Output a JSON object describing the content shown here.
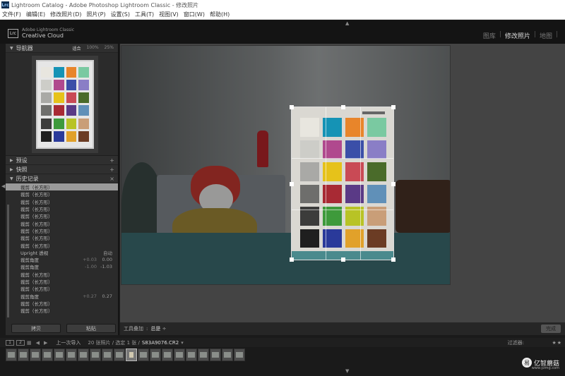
{
  "titlebar": {
    "icon": "Lrc",
    "title": "Lightroom Catalog - Adobe Photoshop Lightroom Classic - 修改照片"
  },
  "menu": [
    "文件(F)",
    "编辑(E)",
    "修改照片(D)",
    "照片(P)",
    "设置(S)",
    "工具(T)",
    "视图(V)",
    "窗口(W)",
    "帮助(H)"
  ],
  "identity": {
    "logo": "Lrc",
    "line1": "Adobe Lightroom Classic",
    "line2": "Creative Cloud"
  },
  "modules": [
    "图库",
    "修改照片",
    "地图"
  ],
  "navigator": {
    "title": "导航器",
    "zoom": [
      "适合",
      "100%",
      "25%"
    ]
  },
  "panels": {
    "presets": "预设",
    "snapshots": "快照",
    "history": "历史记录"
  },
  "history": [
    {
      "label": "裁剪（长方形）",
      "v1": "",
      "v2": ""
    },
    {
      "label": "裁剪（长方形）",
      "v1": "",
      "v2": ""
    },
    {
      "label": "裁剪（长方形）",
      "v1": "",
      "v2": ""
    },
    {
      "label": "裁剪（长方形）",
      "v1": "",
      "v2": ""
    },
    {
      "label": "裁剪（长方形）",
      "v1": "",
      "v2": ""
    },
    {
      "label": "裁剪（长方形）",
      "v1": "",
      "v2": ""
    },
    {
      "label": "裁剪（长方形）",
      "v1": "",
      "v2": ""
    },
    {
      "label": "裁剪（长方形）",
      "v1": "",
      "v2": ""
    },
    {
      "label": "裁剪（长方形）",
      "v1": "",
      "v2": ""
    },
    {
      "label": "Upright 透视",
      "v1": "",
      "v2": "自动"
    },
    {
      "label": "裁剪角度",
      "v1": "+0.03",
      "v2": "0.00"
    },
    {
      "label": "裁剪角度",
      "v1": "-1.00",
      "v2": "-1.03"
    },
    {
      "label": "裁剪（长方形）",
      "v1": "",
      "v2": ""
    },
    {
      "label": "裁剪（长方形）",
      "v1": "",
      "v2": ""
    },
    {
      "label": "裁剪（长方形）",
      "v1": "",
      "v2": ""
    },
    {
      "label": "裁剪角度",
      "v1": "+0.27",
      "v2": "0.27"
    },
    {
      "label": "裁剪（长方形）",
      "v1": "",
      "v2": ""
    },
    {
      "label": "裁剪（长方形）",
      "v1": "",
      "v2": ""
    }
  ],
  "buttons": {
    "copy": "拷贝",
    "paste": "粘贴",
    "done": "完成"
  },
  "toolbar": {
    "label": "工具叠加",
    "value": "总是"
  },
  "filmstrip": {
    "box1": "1",
    "box2": "2",
    "source": "上一次导入",
    "count": "20 张照片 / 选定 1 张 /",
    "file": "S83A9076.CR2",
    "filter_label": "过滤器:",
    "stars": "★★"
  },
  "watermark": {
    "icon": "易",
    "name": "亿智蘑菇",
    "url": "www.yzmg.com"
  },
  "colors": {
    "chart": [
      "#e8e6df",
      "#1593b5",
      "#e8852a",
      "#7ac9a1",
      "#cdcdc8",
      "#b0498e",
      "#3b4fa8",
      "#8a7ec6",
      "#a9a9a6",
      "#e6c21a",
      "#c94a55",
      "#4a6b2a",
      "#6e6e6c",
      "#a82a34",
      "#5a3a86",
      "#6090b8",
      "#3c3c3b",
      "#3e9a3b",
      "#b8c325",
      "#c99e78",
      "#1f1f1f",
      "#2a3a9a",
      "#e1a12a",
      "#6b3c24"
    ]
  }
}
